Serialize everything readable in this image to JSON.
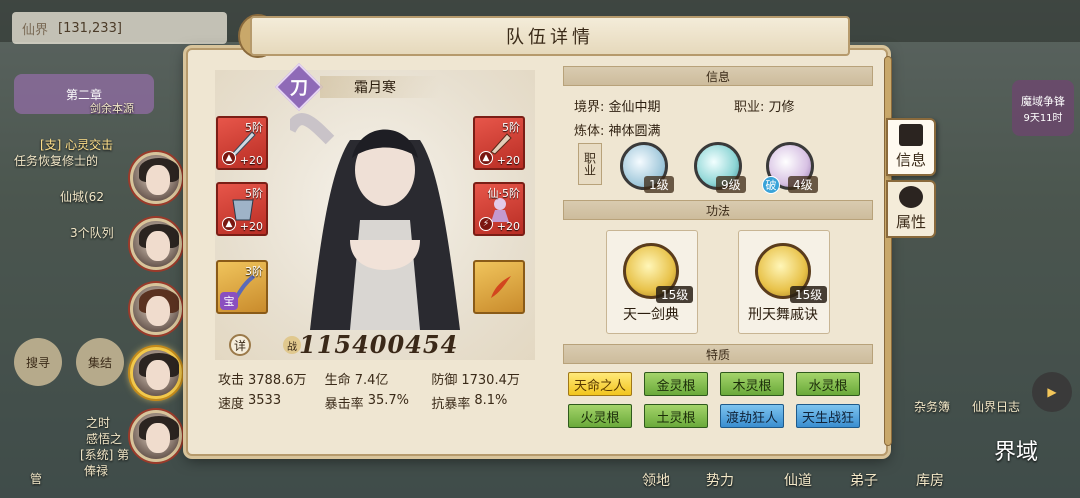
{
  "top": {
    "realm_label": "仙界",
    "realm_value": "[131,233]"
  },
  "panel_title": "队伍详情",
  "hero": {
    "name": "霜月寒",
    "class_glyph": "刀",
    "power_prefix": "战",
    "power": "115400454",
    "detail_label": "详"
  },
  "equipment": [
    {
      "stars": "5阶",
      "plus": "+20"
    },
    {
      "stars": "5阶",
      "plus": "+20"
    },
    {
      "stars": "5阶",
      "plus": "+20"
    },
    {
      "stars": "仙·5阶",
      "plus": "+20"
    },
    {
      "stars": "3阶",
      "badge": "宝"
    }
  ],
  "stats": [
    [
      {
        "label": "攻击",
        "value": "3788.6万"
      },
      {
        "label": "生命",
        "value": "7.4亿"
      },
      {
        "label": "防御",
        "value": "1730.4万"
      }
    ],
    [
      {
        "label": "速度",
        "value": "3533"
      },
      {
        "label": "暴击率",
        "value": "35.7%"
      },
      {
        "label": "抗暴率",
        "value": "8.1%"
      }
    ]
  ],
  "info": {
    "head": "信息",
    "realm_key": "境界:",
    "realm_val": "金仙中期",
    "job_key": "职业:",
    "job_val": "刀修",
    "body_key": "炼体:",
    "body_val": "神体圆满",
    "job_tag": "职业",
    "job_skills": [
      {
        "level": "1级",
        "color": "blue"
      },
      {
        "level": "9级",
        "color": "teal"
      },
      {
        "level": "4级",
        "color": "pink",
        "badge": "破"
      }
    ]
  },
  "techniques": {
    "head": "功法",
    "items": [
      {
        "name": "天一剑典",
        "level": "15级"
      },
      {
        "name": "刑天舞戚诀",
        "level": "15级"
      }
    ]
  },
  "traits": {
    "head": "特质",
    "items": [
      {
        "label": "天命之人",
        "color": "yellow"
      },
      {
        "label": "金灵根",
        "color": "green"
      },
      {
        "label": "木灵根",
        "color": "green"
      },
      {
        "label": "水灵根",
        "color": "green"
      },
      {
        "label": "火灵根",
        "color": "green"
      },
      {
        "label": "土灵根",
        "color": "green"
      },
      {
        "label": "渡劫狂人",
        "color": "blue"
      },
      {
        "label": "天生战狂",
        "color": "blue"
      }
    ]
  },
  "tabs": [
    {
      "label": "信息"
    },
    {
      "label": "属性"
    }
  ],
  "background": {
    "chapter": "第二章",
    "chapter_sub": "剑余本源",
    "task": "[支] 心灵交击",
    "task2": "恢复修士的",
    "task_tag": "任务",
    "city": "仙城(62",
    "teams": "3个队列",
    "btn_search": "搜寻",
    "btn_gather": "集结",
    "log1": "之时",
    "log2": "感悟之",
    "log3": "[系统] 第",
    "log4": "俸禄",
    "right_top": "魔域争锋",
    "right_top_sub": "9天11时",
    "right_a": "杂务簿",
    "right_b": "仙界日志",
    "bottom_1": "领地",
    "bottom_2": "势力",
    "bottom_3": "仙道",
    "bottom_4": "弟子",
    "bottom_5": "库房",
    "bottom_6": "界域",
    "bottom_left": "管"
  }
}
